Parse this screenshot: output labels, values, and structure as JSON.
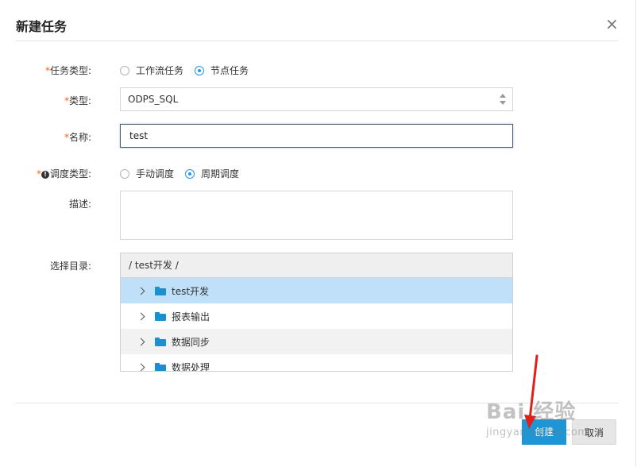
{
  "dialog": {
    "title": "新建任务",
    "close_glyph": "×"
  },
  "form": {
    "required_mark": "*",
    "task_type": {
      "label": "任务类型:",
      "options": [
        {
          "label": "工作流任务",
          "checked": false
        },
        {
          "label": "节点任务",
          "checked": true
        }
      ]
    },
    "type": {
      "label": "类型:",
      "value": "ODPS_SQL"
    },
    "name": {
      "label": "名称:",
      "value": "test"
    },
    "schedule_type": {
      "label": "调度类型:",
      "info_glyph": "!",
      "options": [
        {
          "label": "手动调度",
          "checked": false
        },
        {
          "label": "周期调度",
          "checked": true
        }
      ]
    },
    "description": {
      "label": "描述:",
      "value": ""
    },
    "directory": {
      "label": "选择目录:",
      "path": "/ test开发 /",
      "items": [
        {
          "label": "test开发",
          "selected": true
        },
        {
          "label": "报表输出",
          "selected": false
        },
        {
          "label": "数据同步",
          "selected": false
        },
        {
          "label": "数据处理",
          "selected": false
        }
      ]
    }
  },
  "footer": {
    "create_label": "创建",
    "cancel_label": "取消"
  },
  "watermark": {
    "brand": "Bai 经验",
    "url": "jingyan.baidu.com"
  },
  "colors": {
    "accent": "#1e96d6",
    "required": "#ff6600",
    "selected_row": "#bfe0f8",
    "annotation_arrow": "#e0201a"
  },
  "icons": {
    "close": "close-icon",
    "info": "info-icon",
    "select_arrows": "select-arrows-icon",
    "tree_expand": "chevron-right-icon",
    "folder": "folder-icon"
  }
}
